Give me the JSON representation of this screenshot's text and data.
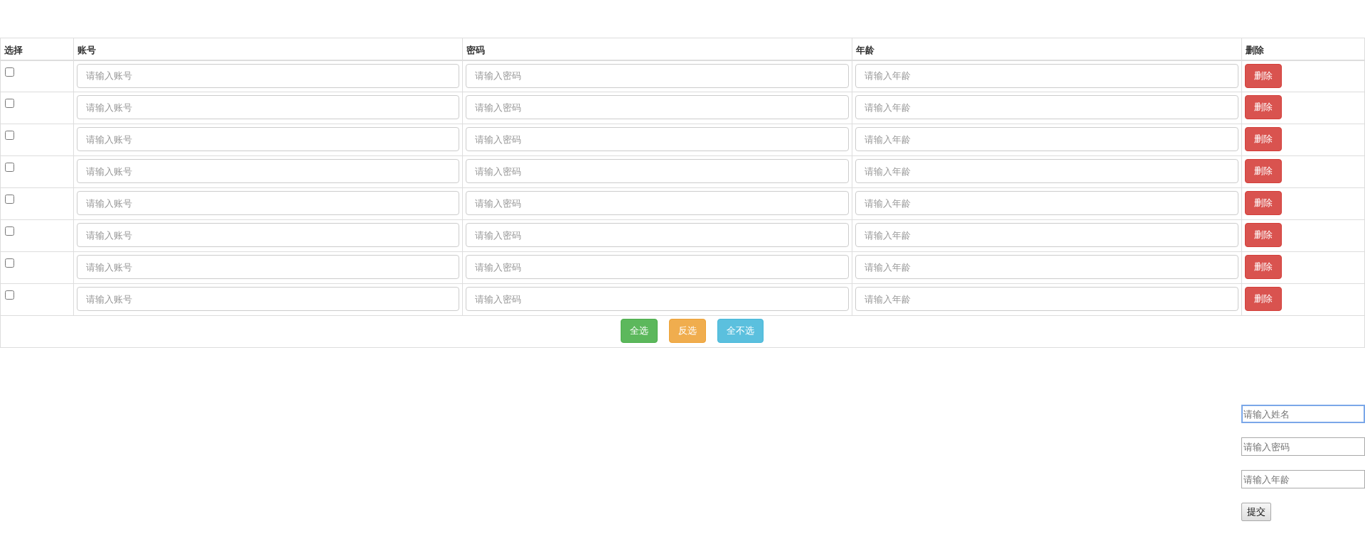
{
  "table": {
    "columns": [
      "选择",
      "账号",
      "密码",
      "年龄",
      "删除"
    ],
    "rows": [
      {
        "checked": false,
        "fields": [
          {
            "placeholder": "请输入账号"
          },
          {
            "placeholder": "请输入密码"
          },
          {
            "placeholder": "请输入年龄"
          }
        ],
        "delete_label": "删除"
      },
      {
        "checked": false,
        "fields": [
          {
            "placeholder": "请输入账号"
          },
          {
            "placeholder": "请输入密码"
          },
          {
            "placeholder": "请输入年龄"
          }
        ],
        "delete_label": "删除"
      },
      {
        "checked": false,
        "fields": [
          {
            "placeholder": "请输入账号"
          },
          {
            "placeholder": "请输入密码"
          },
          {
            "placeholder": "请输入年龄"
          }
        ],
        "delete_label": "删除"
      },
      {
        "checked": false,
        "fields": [
          {
            "placeholder": "请输入账号"
          },
          {
            "placeholder": "请输入密码"
          },
          {
            "placeholder": "请输入年龄"
          }
        ],
        "delete_label": "删除"
      },
      {
        "checked": false,
        "fields": [
          {
            "placeholder": "请输入账号"
          },
          {
            "placeholder": "请输入密码"
          },
          {
            "placeholder": "请输入年龄"
          }
        ],
        "delete_label": "删除"
      },
      {
        "checked": false,
        "fields": [
          {
            "placeholder": "请输入账号"
          },
          {
            "placeholder": "请输入密码"
          },
          {
            "placeholder": "请输入年龄"
          }
        ],
        "delete_label": "删除"
      },
      {
        "checked": false,
        "fields": [
          {
            "placeholder": "请输入账号"
          },
          {
            "placeholder": "请输入密码"
          },
          {
            "placeholder": "请输入年龄"
          }
        ],
        "delete_label": "删除"
      },
      {
        "checked": false,
        "fields": [
          {
            "placeholder": "请输入账号"
          },
          {
            "placeholder": "请输入密码"
          },
          {
            "placeholder": "请输入年龄"
          }
        ],
        "delete_label": "删除"
      }
    ],
    "footer_buttons": [
      {
        "label": "全选",
        "kind": "success"
      },
      {
        "label": "反选",
        "kind": "warning"
      },
      {
        "label": "全不选",
        "kind": "info"
      }
    ]
  },
  "form": {
    "fields": [
      {
        "placeholder": "请输入姓名",
        "focused": true
      },
      {
        "placeholder": "请输入密码",
        "focused": false
      },
      {
        "placeholder": "请输入年龄",
        "focused": false
      }
    ],
    "submit_label": "提交"
  }
}
